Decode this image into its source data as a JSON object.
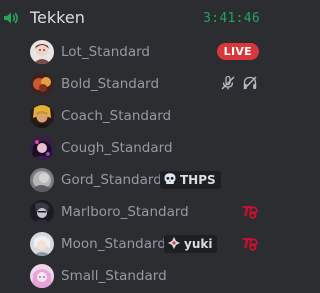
{
  "channel": {
    "icon": "speaker-icon",
    "name": "Tekken",
    "timer": "3:41:46",
    "timer_color": "#23a55a"
  },
  "users": [
    {
      "name": "Lot_Standard",
      "live_label": "LIVE"
    },
    {
      "name": "Bold_Standard",
      "status_icons": [
        "mic-muted-icon",
        "headphones-deafened-icon"
      ]
    },
    {
      "name": "Coach_Standard"
    },
    {
      "name": "Cough_Standard"
    },
    {
      "name": "Gord_Standard",
      "activity": {
        "icon": "skull-icon",
        "text": "THPS"
      }
    },
    {
      "name": "Marlboro_Standard",
      "game_icon": "tekken8-icon"
    },
    {
      "name": "Moon_Standard",
      "activity": {
        "icon": "diamond-icon",
        "text": "yuki"
      },
      "game_icon": "tekken8-icon"
    },
    {
      "name": "Small_Standard"
    }
  ],
  "colors": {
    "background": "#2b2d31",
    "username": "#949ba4",
    "live": "#da373c",
    "tekken_red": "#c8102e"
  }
}
